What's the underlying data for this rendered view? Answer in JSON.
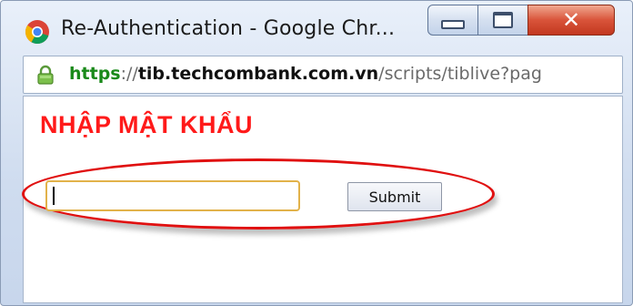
{
  "window": {
    "title": "Re-Authentication - Google Chr...",
    "controls": {
      "minimize_icon": "minimize-icon",
      "maximize_icon": "maximize-icon",
      "close_icon": "close-icon",
      "close_glyph": "✕"
    }
  },
  "address_bar": {
    "secure_icon": "lock-icon",
    "scheme": "https",
    "separator": "://",
    "host": "tib.techcombank.com.vn",
    "path": "/scripts/tiblive?pag"
  },
  "form": {
    "heading": "NHẬP MẬT KHẨU",
    "password_value": "",
    "submit_label": "Submit"
  },
  "colors": {
    "heading": "#ff1a1a",
    "highlight_ellipse": "#e01010",
    "secure_scheme": "#1a8a1a",
    "input_border": "#e2b24a"
  }
}
